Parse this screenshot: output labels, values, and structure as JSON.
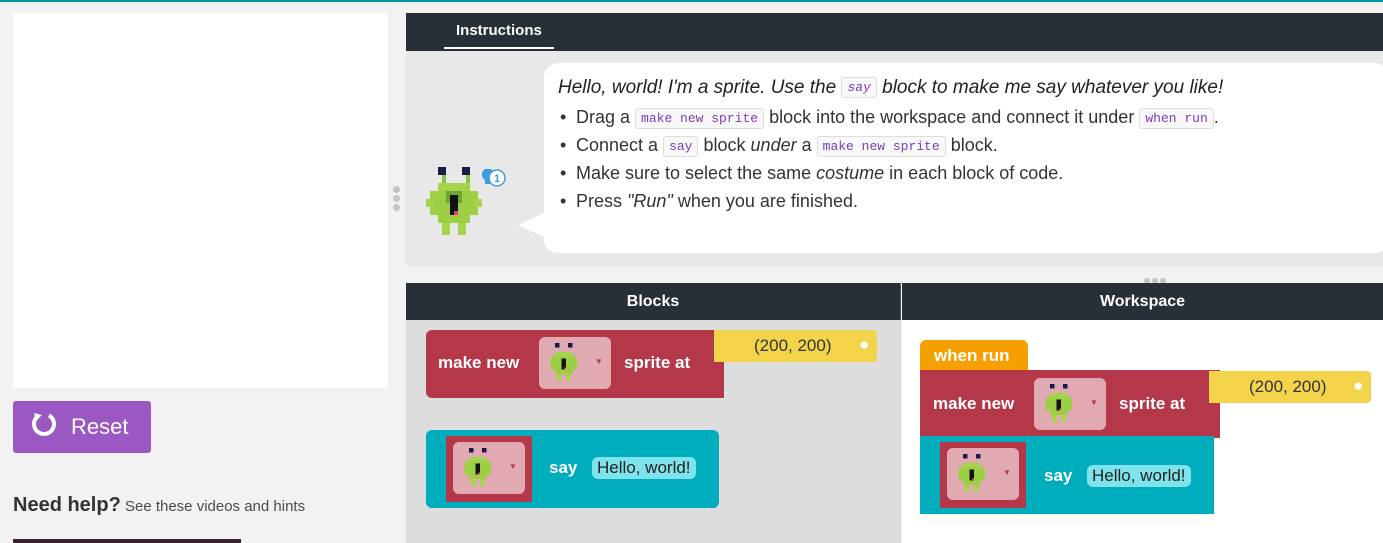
{
  "instructions": {
    "tab_label": "Instructions",
    "intro_before": "Hello, world! I'm a sprite. Use the",
    "intro_code": "say",
    "intro_after": "block to make me say whatever you like!",
    "bullets": [
      {
        "a": "Drag a",
        "code1": "make new sprite",
        "b": "block into the workspace and connect it under",
        "code2": "when run",
        "c": "."
      },
      {
        "a": "Connect a",
        "code1": "say",
        "b": "block",
        "em": "under",
        "b2": "a",
        "code2": "make new sprite",
        "c": "block."
      },
      {
        "a": "Make sure to select the same",
        "em": "costume",
        "c": "in each block of code."
      },
      {
        "a": "Press",
        "em": "\"Run\"",
        "c": "when you are finished."
      }
    ],
    "hint_badge": "1"
  },
  "left": {
    "reset_label": "Reset",
    "help_bold": "Need help?",
    "help_text": "See these videos and hints"
  },
  "headers": {
    "blocks": "Blocks",
    "workspace": "Workspace"
  },
  "toolbox": {
    "make_new_label": "make new",
    "sprite_at_label": "sprite at",
    "position_value": "(200, 200)",
    "say_label": "say",
    "say_value": "Hello, world!"
  },
  "workspace": {
    "when_run_label": "when run",
    "make_new_label": "make new",
    "sprite_at_label": "sprite at",
    "position_value": "(200, 200)",
    "say_label": "say",
    "say_value": "Hello, world!"
  },
  "colors": {
    "accent": "#9b57c2",
    "header": "#292f36",
    "block_red": "#b5374a",
    "block_teal": "#00adbc",
    "block_yellow": "#f2d34a",
    "block_orange": "#f5a000"
  }
}
